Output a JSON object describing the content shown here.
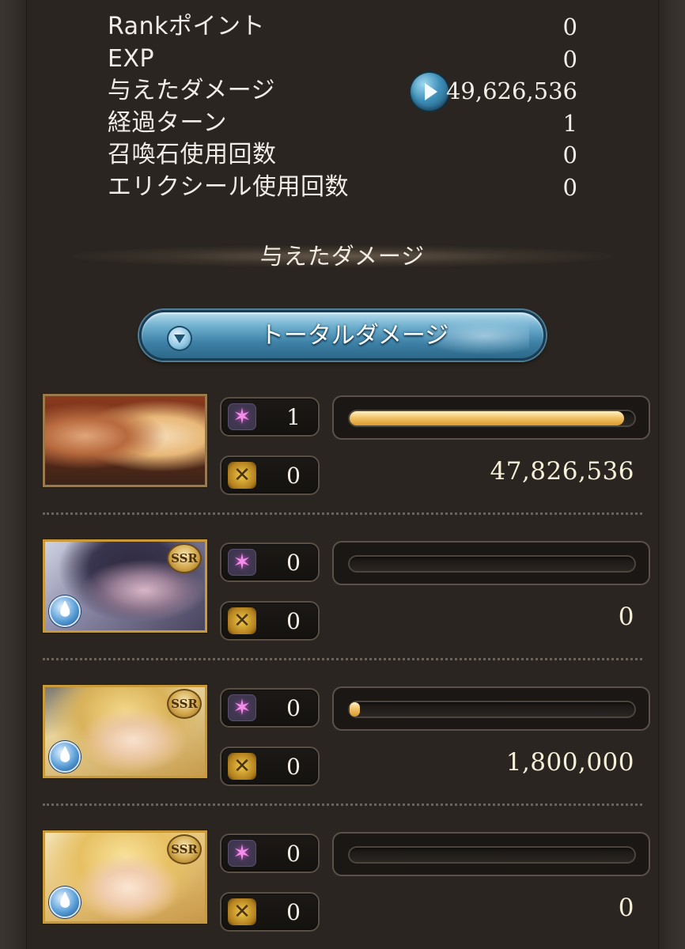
{
  "stats": [
    {
      "label": "Rankポイント",
      "value": "0"
    },
    {
      "label": "EXP",
      "value": "0"
    },
    {
      "label": "与えたダメージ",
      "value": "49,626,536"
    },
    {
      "label": "経過ターン",
      "value": "1"
    },
    {
      "label": "召喚石使用回数",
      "value": "0"
    },
    {
      "label": "エリクシール使用回数",
      "value": "0"
    }
  ],
  "section_title": "与えたダメージ",
  "dropdown": {
    "label": "トータルダメージ"
  },
  "party": [
    {
      "ougi_count": "1",
      "chain_count": "0",
      "damage": "47,826,536",
      "bar_fraction": 0.964
    },
    {
      "badge": "SSR",
      "ougi_count": "0",
      "chain_count": "0",
      "damage": "0",
      "bar_fraction": 0
    },
    {
      "badge": "SSR",
      "ougi_count": "0",
      "chain_count": "0",
      "damage": "1,800,000",
      "bar_fraction": 0.036
    },
    {
      "badge": "SSR",
      "ougi_count": "0",
      "chain_count": "0",
      "damage": "0",
      "bar_fraction": 0
    }
  ],
  "colors": {
    "background": "#2a2520",
    "bar_fill": "#f2c56b",
    "dropdown_blue": "#3f82a8",
    "ougi_icon": "#f38fe8",
    "chain_icon": "#f0c84a"
  },
  "icons": {
    "play": "play-icon",
    "dropdown": "chevron-down-icon",
    "ougi": "ougi-sparkle-icon",
    "chain": "chain-burst-icon",
    "element": "water-element-icon"
  }
}
